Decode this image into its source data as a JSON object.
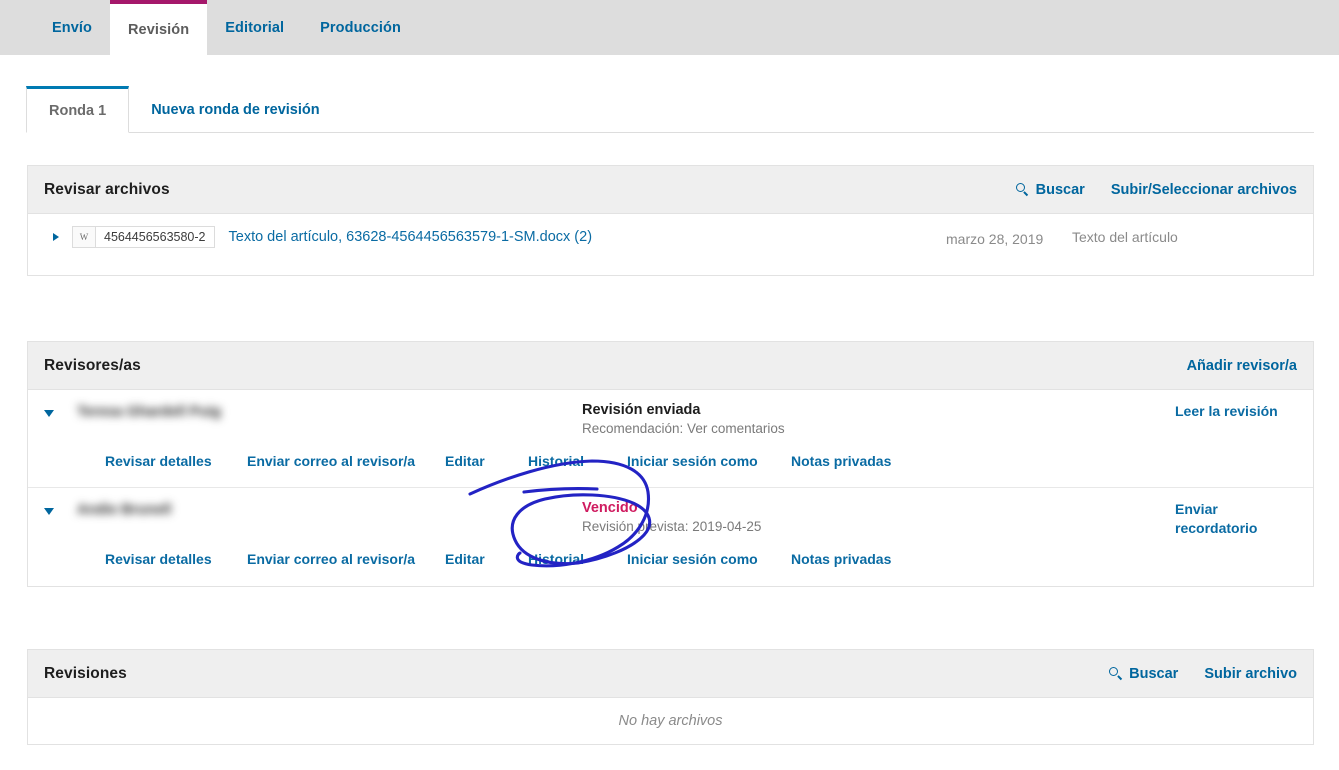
{
  "workflow_tabs": [
    {
      "label": "Envío",
      "active": false
    },
    {
      "label": "Revisión",
      "active": true
    },
    {
      "label": "Editorial",
      "active": false
    },
    {
      "label": "Producción",
      "active": false
    }
  ],
  "round_tabs": [
    {
      "label": "Ronda 1",
      "active": true
    },
    {
      "label": "Nueva ronda de revisión",
      "active": false
    }
  ],
  "files_panel": {
    "title": "Revisar archivos",
    "search_label": "Buscar",
    "upload_label": "Subir/Seleccionar archivos",
    "rows": [
      {
        "file_id": "4564456563580-2",
        "icon": "word-doc-icon",
        "name": "Texto del artículo, 63628-4564456563579-1-SM.docx (2)",
        "date": "marzo 28, 2019",
        "type": "Texto del artículo"
      }
    ]
  },
  "reviewers_panel": {
    "title": "Revisores/as",
    "add_label": "Añadir revisor/a",
    "actions": {
      "details": "Revisar detalles",
      "email": "Enviar correo al revisor/a",
      "edit": "Editar",
      "history": "Historial",
      "login_as": "Iniciar sesión como",
      "private_notes": "Notas privadas"
    },
    "rows": [
      {
        "name": "Teresa Ghardell Puig",
        "name_redacted": true,
        "status": "Revisión enviada",
        "status_overdue": false,
        "substatus": "Recomendación: Ver comentarios",
        "side_action": "Leer la revisión"
      },
      {
        "name": "Andie Brunell",
        "name_redacted": true,
        "status": "Vencido",
        "status_overdue": true,
        "substatus": "Revisión prevista: 2019-04-25",
        "side_action": "Enviar recordatorio"
      }
    ]
  },
  "revisions_panel": {
    "title": "Revisiones",
    "search_label": "Buscar",
    "upload_label": "Subir archivo",
    "empty_text": "No hay archivos"
  },
  "annotation": {
    "type": "hand-drawn-ellipse",
    "color": "#2020c0",
    "target": "Vencido"
  },
  "colors": {
    "link": "#00669e",
    "active_tab_border": "#a5186b",
    "round_tab_border": "#007ab2",
    "overdue": "#cf1b5f",
    "panel_header_bg": "#efefef",
    "topbar_bg": "#dddddd"
  }
}
